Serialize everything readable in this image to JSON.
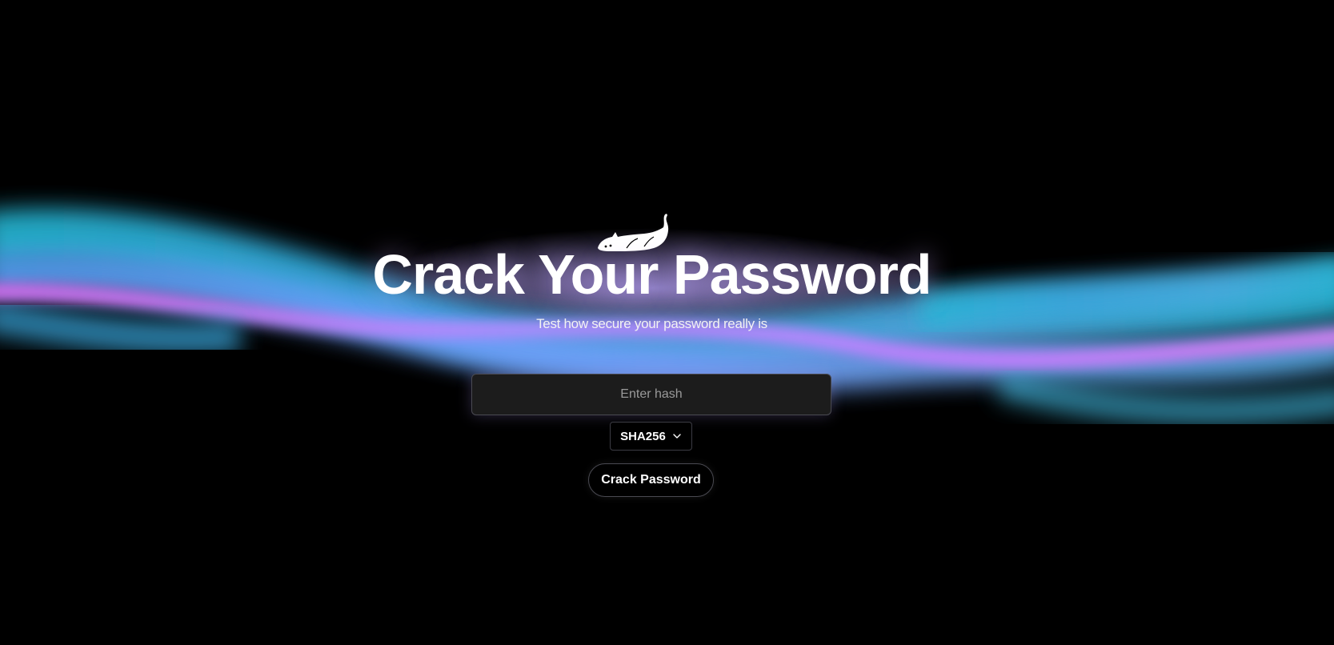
{
  "hero": {
    "title": "Crack Your Password",
    "subtitle": "Test how secure your password really is",
    "logo_icon": "cat-lying-icon"
  },
  "form": {
    "hash_placeholder": "Enter hash",
    "hash_value": "",
    "algorithm": {
      "selected": "SHA256"
    },
    "submit_label": "Crack Password"
  },
  "theme": {
    "background": "#000000",
    "wave_colors": [
      "#2ec4e0",
      "#c77dff",
      "#6aa8ff"
    ]
  }
}
